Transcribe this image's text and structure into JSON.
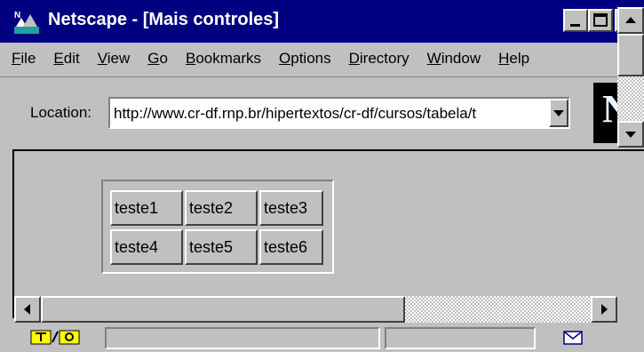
{
  "window": {
    "title": "Netscape - [Mais controles]",
    "minimize_label": "",
    "maximize_label": "",
    "close_label": ""
  },
  "menu": {
    "items": [
      {
        "key": "F",
        "rest": "ile"
      },
      {
        "key": "E",
        "rest": "dit"
      },
      {
        "key": "V",
        "rest": "iew"
      },
      {
        "key": "G",
        "rest": "o"
      },
      {
        "key": "B",
        "rest": "ookmarks"
      },
      {
        "key": "O",
        "rest": "ptions"
      },
      {
        "key": "D",
        "rest": "irectory"
      },
      {
        "key": "W",
        "rest": "indow"
      },
      {
        "key": "H",
        "rest": "elp"
      }
    ]
  },
  "location": {
    "label": "Location:",
    "url": "http://www.cr-df.rnp.br/hipertextos/cr-df/cursos/tabela/t"
  },
  "logo": {
    "letter": "N"
  },
  "table": {
    "rows": [
      [
        "teste1",
        "teste2",
        "teste3"
      ],
      [
        "teste4",
        "teste5",
        "teste6"
      ]
    ]
  },
  "icons": {
    "title": "netscape-app-icon",
    "status": "security-key-icon",
    "mail": "mail-envelope-icon"
  },
  "colors": {
    "titlebar": "#000080",
    "chrome": "#c0c0c0",
    "logo_bg": "#000000"
  }
}
